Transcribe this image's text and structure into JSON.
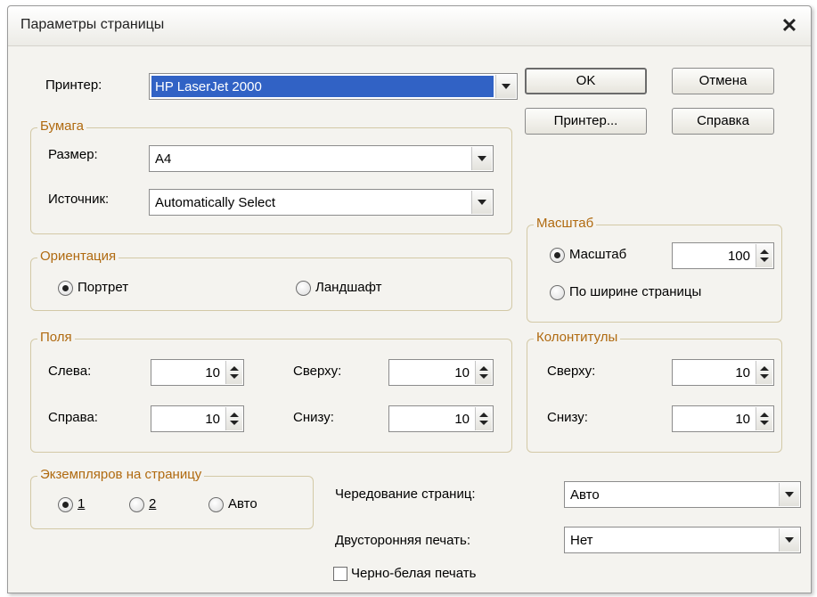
{
  "window": {
    "title": "Параметры страницы"
  },
  "printer": {
    "label": "Принтер:",
    "value": "HP LaserJet 2000"
  },
  "buttons": {
    "ok": "OK",
    "cancel": "Отмена",
    "printer": "Принтер...",
    "help": "Справка"
  },
  "paper": {
    "title": "Бумага",
    "size_label": "Размер:",
    "size_value": "A4",
    "source_label": "Источник:",
    "source_value": "Automatically Select"
  },
  "scale": {
    "title": "Масштаб",
    "scale_option": "Масштаб",
    "scale_value": "100",
    "fit_option": "По ширине страницы",
    "selected": "scale"
  },
  "orientation": {
    "title": "Ориентация",
    "portrait": "Портрет",
    "landscape": "Ландшафт",
    "selected": "portrait"
  },
  "margins": {
    "title": "Поля",
    "left_label": "Слева:",
    "left_value": "10",
    "right_label": "Справа:",
    "right_value": "10",
    "top_label": "Сверху:",
    "top_value": "10",
    "bottom_label": "Снизу:",
    "bottom_value": "10"
  },
  "headers": {
    "title": "Колонтитулы",
    "top_label": "Сверху:",
    "top_value": "10",
    "bottom_label": "Снизу:",
    "bottom_value": "10"
  },
  "copies": {
    "title": "Экземпляров на страницу",
    "one": "1",
    "two": "2",
    "auto": "Авто",
    "selected": "1"
  },
  "alternation": {
    "label": "Чередование страниц:",
    "value": "Авто"
  },
  "duplex": {
    "label": "Двусторонняя печать:",
    "value": "Нет"
  },
  "bw": {
    "label": "Черно-белая печать",
    "checked": false
  },
  "colors": {
    "group_title": "#b06a10",
    "selection": "#3162c5"
  }
}
